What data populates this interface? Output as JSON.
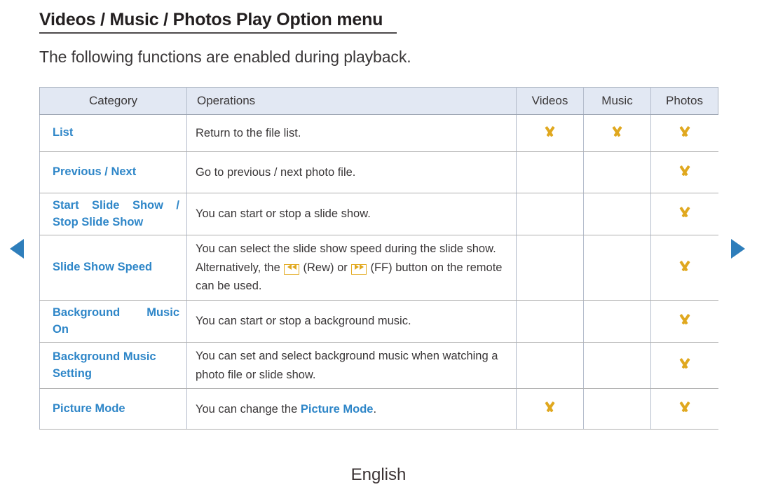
{
  "page": {
    "title": "Videos / Music / Photos Play Option menu",
    "subtitle": "The following functions are enabled during playback.",
    "footer_language": "English"
  },
  "nav": {
    "prev_icon": "triangle-left-icon",
    "next_icon": "triangle-right-icon",
    "arrow_color": "#2e7ebb"
  },
  "colors": {
    "category_blue": "#2e86c8",
    "check_amber": "#e0a81f",
    "header_bg": "#e2e8f3",
    "text": "#3a3738"
  },
  "table": {
    "columns": [
      "Category",
      "Operations",
      "Videos",
      "Music",
      "Photos"
    ],
    "rows": [
      {
        "category": "List",
        "category_justified": false,
        "operations_parts": [
          {
            "type": "text",
            "text": "Return to the file list."
          }
        ],
        "videos": true,
        "music": true,
        "photos": true
      },
      {
        "category": "Previous / Next",
        "category_justified": false,
        "operations_parts": [
          {
            "type": "text",
            "text": "Go to previous / next photo file."
          }
        ],
        "videos": false,
        "music": false,
        "photos": true
      },
      {
        "category": "Start Slide Show / Stop Slide Show",
        "category_line1": "Start Slide Show /",
        "category_line2": "Stop Slide Show",
        "category_justified": true,
        "operations_parts": [
          {
            "type": "text",
            "text": "You can start or stop a slide show."
          }
        ],
        "videos": false,
        "music": false,
        "photos": true
      },
      {
        "category": "Slide Show Speed",
        "category_justified": false,
        "operations_parts": [
          {
            "type": "text",
            "text": "You can select the slide show speed during the slide show. Alternatively, the "
          },
          {
            "type": "key",
            "icon": "rewind-button-icon",
            "label": "Rew"
          },
          {
            "type": "text",
            "text": " (Rew) or "
          },
          {
            "type": "key",
            "icon": "fast-forward-button-icon",
            "label": "FF"
          },
          {
            "type": "text",
            "text": " (FF) button on the remote can be used."
          }
        ],
        "videos": false,
        "music": false,
        "photos": true
      },
      {
        "category": "Background Music On",
        "category_line1": "Background Music",
        "category_line2": "On",
        "category_justified": true,
        "operations_parts": [
          {
            "type": "text",
            "text": "You can start or stop a background music."
          }
        ],
        "videos": false,
        "music": false,
        "photos": true
      },
      {
        "category": "Background Music Setting",
        "category_line1": "Background Music",
        "category_line2": "Setting",
        "category_justified": false,
        "operations_parts": [
          {
            "type": "text",
            "text": "You can set and select background music when watching a photo file or slide show."
          }
        ],
        "videos": false,
        "music": false,
        "photos": true
      },
      {
        "category": "Picture Mode",
        "category_justified": false,
        "operations_parts": [
          {
            "type": "text",
            "text": "You can change the "
          },
          {
            "type": "link",
            "text": "Picture Mode"
          },
          {
            "type": "text",
            "text": "."
          }
        ],
        "videos": true,
        "music": false,
        "photos": true
      }
    ]
  }
}
